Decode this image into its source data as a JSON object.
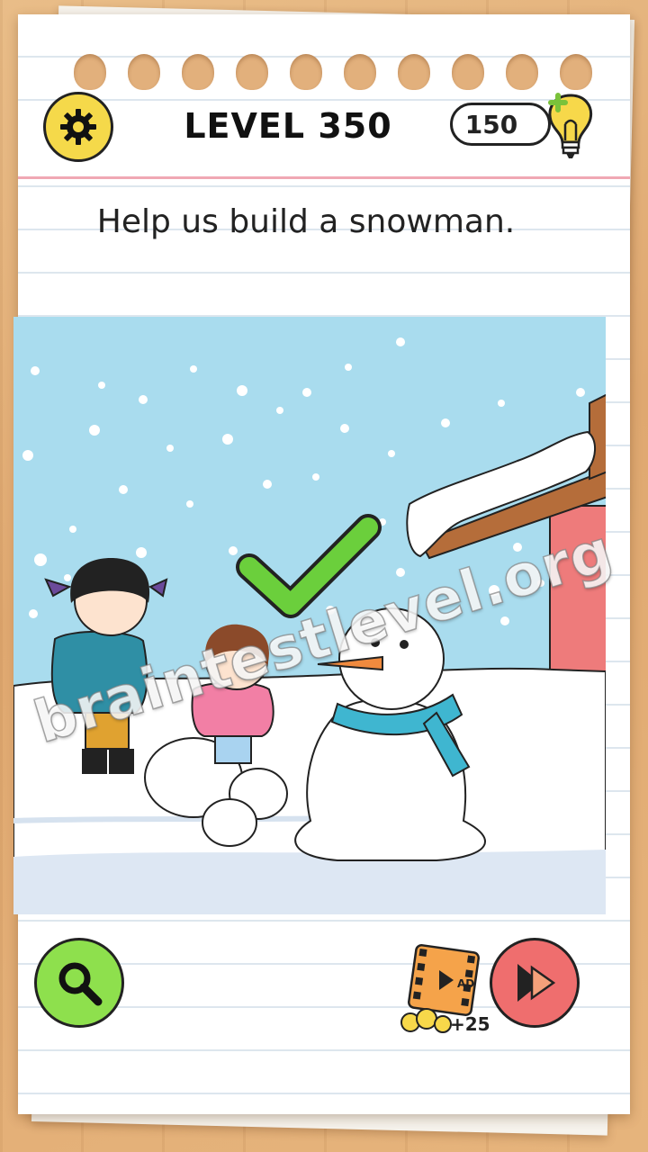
{
  "header": {
    "level_label": "LEVEL 350",
    "hint_count": "150"
  },
  "question": {
    "text": "Help us build a snowman."
  },
  "watermark": {
    "text": "braintestlevel.org"
  },
  "footer": {
    "ad_reward": "+25",
    "ad_badge": "AD"
  },
  "colors": {
    "settings_button": "#f5d94a",
    "hint_button": "#8ee04d",
    "skip_button": "#ef6e6e",
    "sky": "#a9dcee",
    "checkmark": "#6bcf3c"
  },
  "icons": {
    "settings": "gear-icon",
    "hint": "magnifier-icon",
    "skip": "fast-forward-icon",
    "hints_shop": "lightbulb-plus-icon",
    "watch_ad": "film-ad-icon"
  }
}
